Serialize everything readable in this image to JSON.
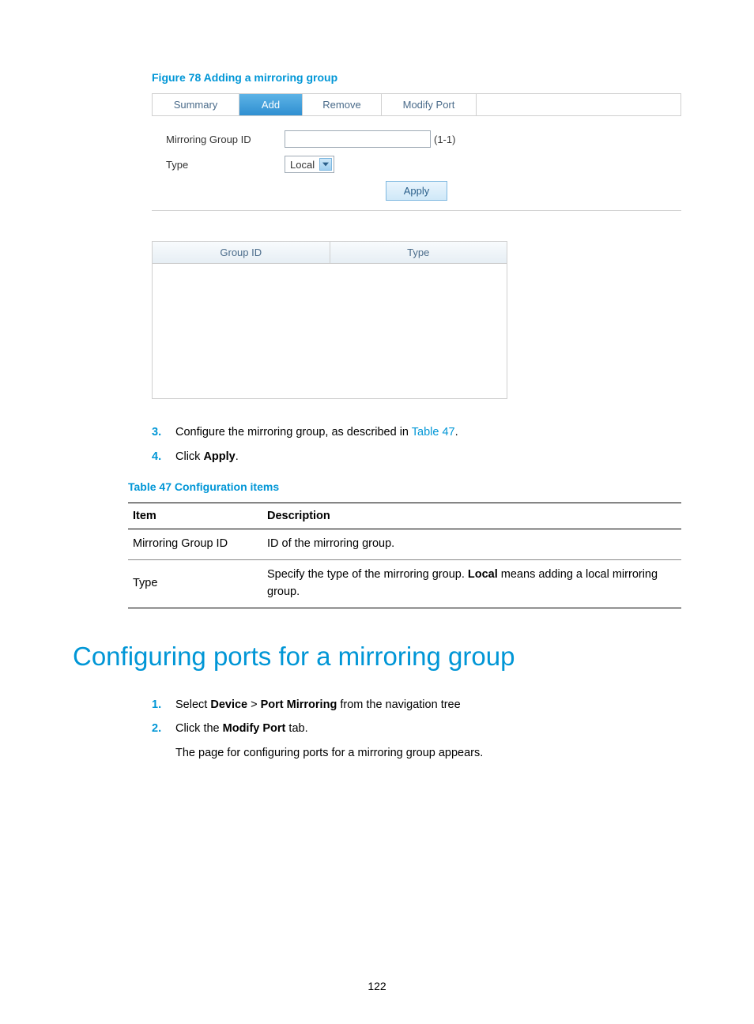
{
  "figure": {
    "caption": "Figure 78 Adding a mirroring group"
  },
  "tabs": {
    "summary": "Summary",
    "add": "Add",
    "remove": "Remove",
    "modify": "Modify Port"
  },
  "form": {
    "group_id_label": "Mirroring Group ID",
    "group_id_range": "(1-1)",
    "type_label": "Type",
    "type_value": "Local",
    "apply_label": "Apply"
  },
  "datagrid": {
    "col_group_id": "Group ID",
    "col_type": "Type"
  },
  "steps_a": {
    "s3_num": "3.",
    "s3_text_before": "Configure the mirroring group, as described in ",
    "s3_link": "Table 47",
    "s3_text_after": ".",
    "s4_num": "4.",
    "s4_prefix": "Click ",
    "s4_bold": "Apply",
    "s4_suffix": "."
  },
  "table47": {
    "caption": "Table 47 Configuration items",
    "col_item": "Item",
    "col_desc": "Description",
    "row1_item": "Mirroring Group ID",
    "row1_desc": "ID of the mirroring group.",
    "row2_item": "Type",
    "row2_desc_before": "Specify the type of the mirroring group. ",
    "row2_desc_bold": "Local",
    "row2_desc_after": " means adding a local mirroring group."
  },
  "heading": "Configuring ports for a mirroring group",
  "steps_b": {
    "s1_num": "1.",
    "s1_prefix": "Select ",
    "s1_bold1": "Device",
    "s1_mid": " > ",
    "s1_bold2": "Port Mirroring",
    "s1_suffix": " from the navigation tree",
    "s2_num": "2.",
    "s2_prefix": "Click the ",
    "s2_bold": "Modify Port",
    "s2_suffix": " tab.",
    "s2_line2": "The page for configuring ports for a mirroring group appears."
  },
  "page_number": "122"
}
